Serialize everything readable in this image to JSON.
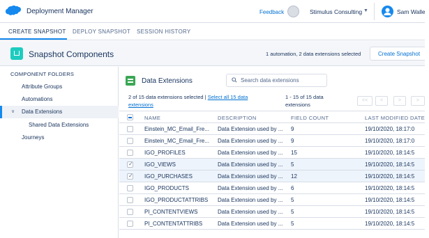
{
  "app": {
    "title": "Deployment Manager",
    "feedback_label": "Feedback",
    "org_name": "Stimulus Consulting",
    "user_name": "Sam Walle"
  },
  "tabs": [
    {
      "label": "CREATE SNAPSHOT",
      "active": true
    },
    {
      "label": "DEPLOY SNAPSHOT",
      "active": false
    },
    {
      "label": "SESSION HISTORY",
      "active": false
    }
  ],
  "header": {
    "title": "Snapshot Components",
    "selection_summary": "1 automation, 2 data extensions selected",
    "create_button": "Create Snapshot"
  },
  "sidebar": {
    "heading": "COMPONENT FOLDERS",
    "items": [
      {
        "label": "Attribute Groups",
        "active": false
      },
      {
        "label": "Automations",
        "active": false
      },
      {
        "label": "Data Extensions",
        "active": true,
        "expanded": true
      },
      {
        "label": "Shared Data Extensions",
        "active": false
      },
      {
        "label": "Journeys",
        "active": false
      }
    ]
  },
  "panel": {
    "title": "Data Extensions",
    "search_placeholder": "Search data extensions",
    "selected_text": "2 of 15 data extensions selected |",
    "select_all_link_line1": "Select all 15 data",
    "select_all_link_line2": "extensions",
    "range_line1": "1 - 15 of 15 data",
    "range_line2": "extensions",
    "pager": {
      "first": "<<",
      "prev": "<",
      "next": ">",
      "last": ">"
    }
  },
  "table": {
    "columns": [
      "NAME",
      "DESCRIPTION",
      "FIELD COUNT",
      "LAST MODIFIED DATE"
    ],
    "rows": [
      {
        "name": "Einstein_MC_Email_Fre...",
        "description": "Data Extension used by ...",
        "field_count": "9",
        "modified": "19/10/2020, 18:17:0",
        "selected": false
      },
      {
        "name": "Einstein_MC_Email_Fre...",
        "description": "Data Extension used by ...",
        "field_count": "9",
        "modified": "19/10/2020, 18:17:0",
        "selected": false
      },
      {
        "name": "IGO_PROFILES",
        "description": "Data Extension used by ...",
        "field_count": "15",
        "modified": "19/10/2020, 18:14:5",
        "selected": false
      },
      {
        "name": "IGO_VIEWS",
        "description": "Data Extension used by ...",
        "field_count": "5",
        "modified": "19/10/2020, 18:14:5",
        "selected": true
      },
      {
        "name": "IGO_PURCHASES",
        "description": "Data Extension used by ...",
        "field_count": "12",
        "modified": "19/10/2020, 18:14:5",
        "selected": true
      },
      {
        "name": "IGO_PRODUCTS",
        "description": "Data Extension used by ...",
        "field_count": "6",
        "modified": "19/10/2020, 18:14:5",
        "selected": false
      },
      {
        "name": "IGO_PRODUCTATTRIBS",
        "description": "Data Extension used by ...",
        "field_count": "5",
        "modified": "19/10/2020, 18:14:5",
        "selected": false
      },
      {
        "name": "PI_CONTENTVIEWS",
        "description": "Data Extension used by ...",
        "field_count": "5",
        "modified": "19/10/2020, 18:14:5",
        "selected": false
      },
      {
        "name": "PI_CONTENTATTRIBS",
        "description": "Data Extension used by ...",
        "field_count": "5",
        "modified": "19/10/2020, 18:14:5",
        "selected": false
      }
    ]
  },
  "colors": {
    "accent": "#1589ee",
    "link": "#0070d2",
    "text": "#16325c",
    "header_bg": "#f4f6f9",
    "selected_row": "#eef4fb",
    "data_ext_icon": "#3ba755",
    "snapshot_icon": "#1dccbf"
  }
}
